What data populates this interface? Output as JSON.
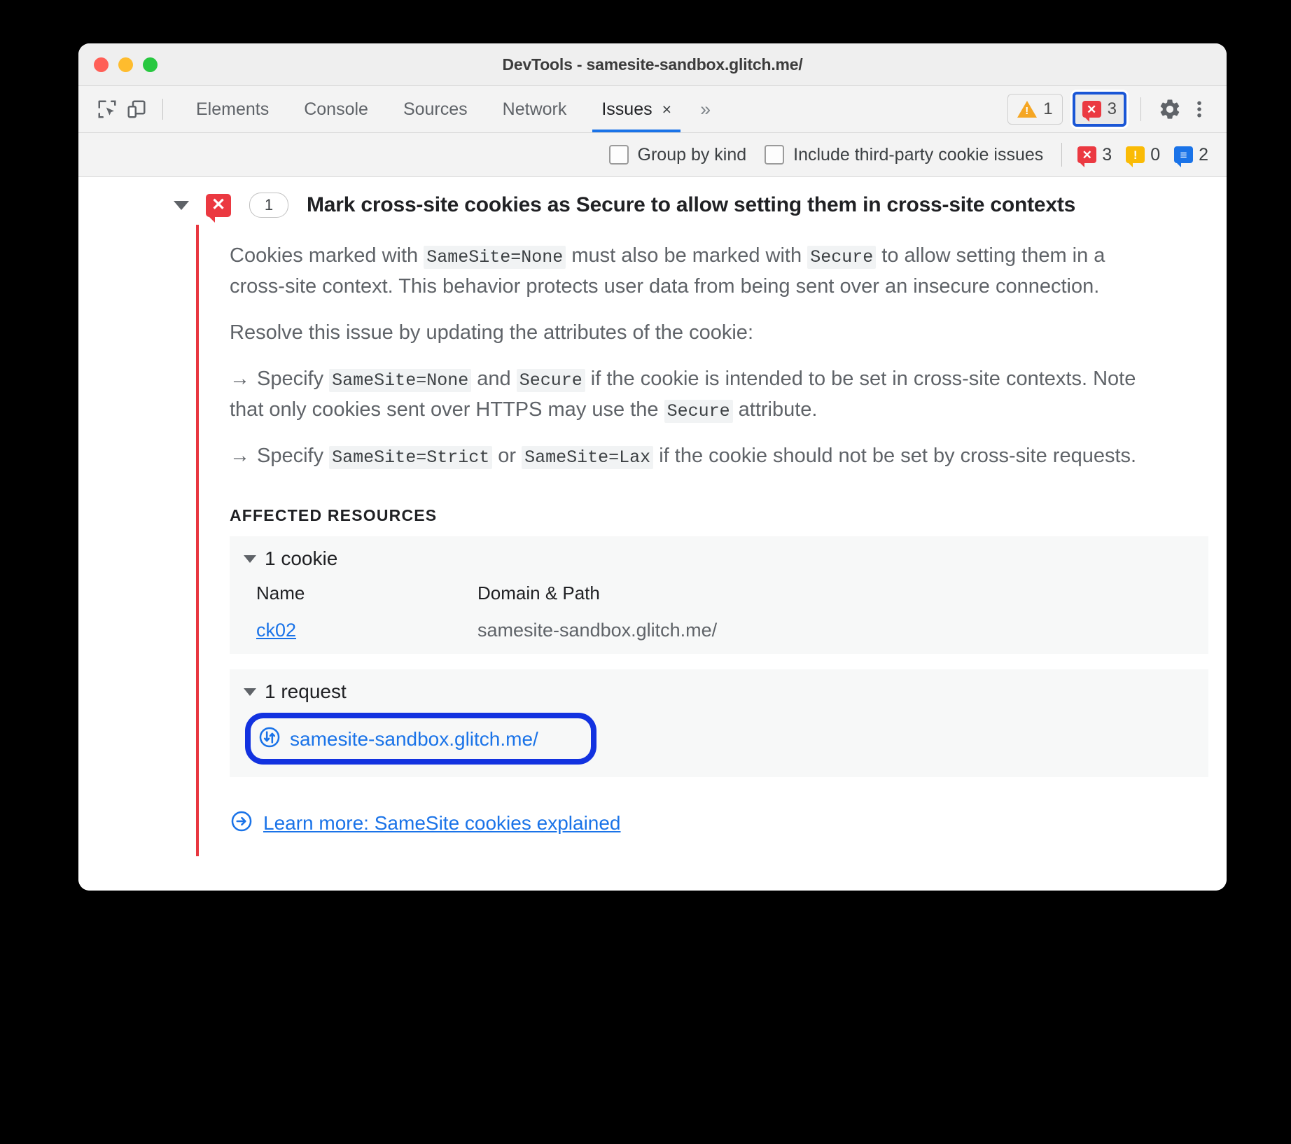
{
  "window": {
    "title": "DevTools - samesite-sandbox.glitch.me/",
    "traffic_lights": [
      "close-red",
      "minimize-yellow",
      "zoom-green"
    ]
  },
  "toolbar": {
    "inspect_icon": "inspect-element-icon",
    "device_icon": "device-toolbar-icon",
    "tabs": [
      {
        "label": "Elements",
        "active": false
      },
      {
        "label": "Console",
        "active": false
      },
      {
        "label": "Sources",
        "active": false
      },
      {
        "label": "Network",
        "active": false
      },
      {
        "label": "Issues",
        "active": true
      }
    ],
    "tab_close_glyph": "×",
    "more_tabs_glyph": "»",
    "warning_badge": {
      "icon": "warning-triangle-icon",
      "count": "1"
    },
    "error_badge": {
      "icon": "error-bubble-icon",
      "count": "3",
      "focused": true
    },
    "settings_icon": "gear-icon",
    "more_options_icon": "kebab-menu-icon"
  },
  "filterbar": {
    "group_by_kind": {
      "label": "Group by kind",
      "checked": false
    },
    "include_third_party": {
      "label": "Include third-party cookie issues",
      "checked": false
    },
    "counts": [
      {
        "kind": "error",
        "icon": "error-bubble-icon",
        "value": "3",
        "color": "#eb3941"
      },
      {
        "kind": "warning",
        "icon": "warning-bubble-icon",
        "value": "0",
        "color": "#fabb05"
      },
      {
        "kind": "info",
        "icon": "info-bubble-icon",
        "value": "2",
        "color": "#1a73e8"
      }
    ]
  },
  "issue": {
    "expanded": true,
    "severity_icon": "error-bubble-icon",
    "severity_glyph": "×",
    "count": "1",
    "title": "Mark cross-site cookies as Secure to allow setting them in cross-site contexts",
    "accent_color": "#e8363f",
    "paragraphs": [
      {
        "id": "p1",
        "parts": [
          {
            "t": "text",
            "v": "Cookies marked with "
          },
          {
            "t": "code",
            "v": "SameSite=None"
          },
          {
            "t": "text",
            "v": " must also be marked with "
          },
          {
            "t": "code",
            "v": "Secure"
          },
          {
            "t": "text",
            "v": " to allow setting them in a cross-site context. This behavior protects user data from being sent over an insecure connection."
          }
        ]
      },
      {
        "id": "p2",
        "parts": [
          {
            "t": "text",
            "v": "Resolve this issue by updating the attributes of the cookie:"
          }
        ]
      },
      {
        "id": "p3",
        "parts": [
          {
            "t": "arrow",
            "v": "→"
          },
          {
            "t": "text",
            "v": "Specify "
          },
          {
            "t": "code",
            "v": "SameSite=None"
          },
          {
            "t": "text",
            "v": " and "
          },
          {
            "t": "code",
            "v": "Secure"
          },
          {
            "t": "text",
            "v": " if the cookie is intended to be set in cross-site contexts. Note that only cookies sent over HTTPS may use the "
          },
          {
            "t": "code",
            "v": "Secure"
          },
          {
            "t": "text",
            "v": " attribute."
          }
        ]
      },
      {
        "id": "p4",
        "parts": [
          {
            "t": "arrow",
            "v": "→"
          },
          {
            "t": "text",
            "v": "Specify "
          },
          {
            "t": "code",
            "v": "SameSite=Strict"
          },
          {
            "t": "text",
            "v": " or "
          },
          {
            "t": "code",
            "v": "SameSite=Lax"
          },
          {
            "t": "text",
            "v": " if the cookie should not be set by cross-site requests."
          }
        ]
      }
    ],
    "affected_resources_label": "AFFECTED RESOURCES",
    "cookie_group": {
      "title": "1 cookie",
      "expanded": true,
      "columns": [
        "Name",
        "Domain & Path"
      ],
      "rows": [
        {
          "name": "ck02",
          "domain_path": "samesite-sandbox.glitch.me/"
        }
      ]
    },
    "request_group": {
      "title": "1 request",
      "expanded": true,
      "icon": "network-request-icon",
      "url": "samesite-sandbox.glitch.me/",
      "annotation": {
        "shape": "rounded-rect-highlight",
        "color": "#1232e0"
      }
    },
    "learn_more": {
      "icon": "arrow-in-circle-icon",
      "label": "Learn more: SameSite cookies explained"
    }
  }
}
